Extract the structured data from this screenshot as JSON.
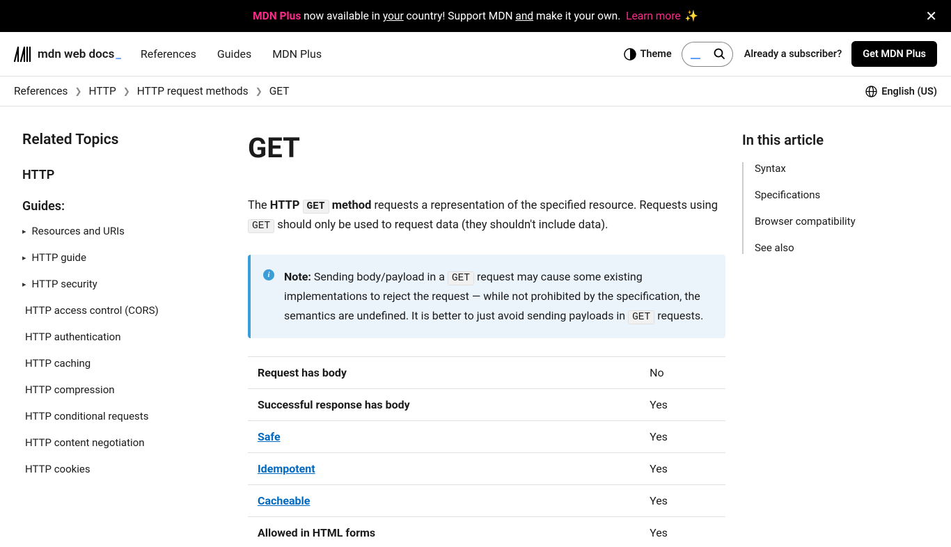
{
  "banner": {
    "mdnplus": "MDN Plus",
    "t1": " now available in ",
    "your": "your",
    "t2": " country! Support MDN ",
    "and": "and",
    "t3": " make it your own. ",
    "learn": "Learn more",
    "sparkle": "✨"
  },
  "nav": {
    "logo": "mdn web docs",
    "underscore": "_",
    "links": {
      "references": "References",
      "guides": "Guides",
      "mdnplus": "MDN Plus"
    },
    "theme": "Theme",
    "subscriber": "Already a subscriber?",
    "getplus": "Get MDN Plus"
  },
  "crumbs": {
    "references": "References",
    "http": "HTTP",
    "methods": "HTTP request methods",
    "get": "GET",
    "lang": "English (US)"
  },
  "sidebar": {
    "title": "Related Topics",
    "httplink": "HTTP",
    "guides_label": "Guides:",
    "collapsible": [
      "Resources and URIs",
      "HTTP guide",
      "HTTP security"
    ],
    "flat": [
      "HTTP access control (CORS)",
      "HTTP authentication",
      "HTTP caching",
      "HTTP compression",
      "HTTP conditional requests",
      "HTTP content negotiation",
      "HTTP cookies"
    ]
  },
  "main": {
    "title": "GET",
    "intro": {
      "t1": "The ",
      "strong1": "HTTP ",
      "code1": "GET",
      "strong2": " method",
      "t2": " requests a representation of the specified resource. Requests using ",
      "code2": "GET",
      "t3": " should only be used to request data (they shouldn't include data)."
    },
    "note": {
      "label": "Note:",
      "t1": " Sending body/payload in a ",
      "code1": "GET",
      "t2": " request may cause some existing implementations to reject the request — while not prohibited by the specification, the semantics are undefined. It is better to just avoid sending payloads in ",
      "code2": "GET",
      "t3": " requests."
    },
    "table": [
      {
        "label": "Request has body",
        "link": false,
        "value": "No"
      },
      {
        "label": "Successful response has body",
        "link": false,
        "value": "Yes"
      },
      {
        "label": "Safe",
        "link": true,
        "value": "Yes"
      },
      {
        "label": "Idempotent",
        "link": true,
        "value": "Yes"
      },
      {
        "label": "Cacheable",
        "link": true,
        "value": "Yes"
      },
      {
        "label": "Allowed in HTML forms",
        "link": false,
        "value": "Yes"
      }
    ]
  },
  "toc": {
    "title": "In this article",
    "items": [
      "Syntax",
      "Specifications",
      "Browser compatibility",
      "See also"
    ]
  }
}
